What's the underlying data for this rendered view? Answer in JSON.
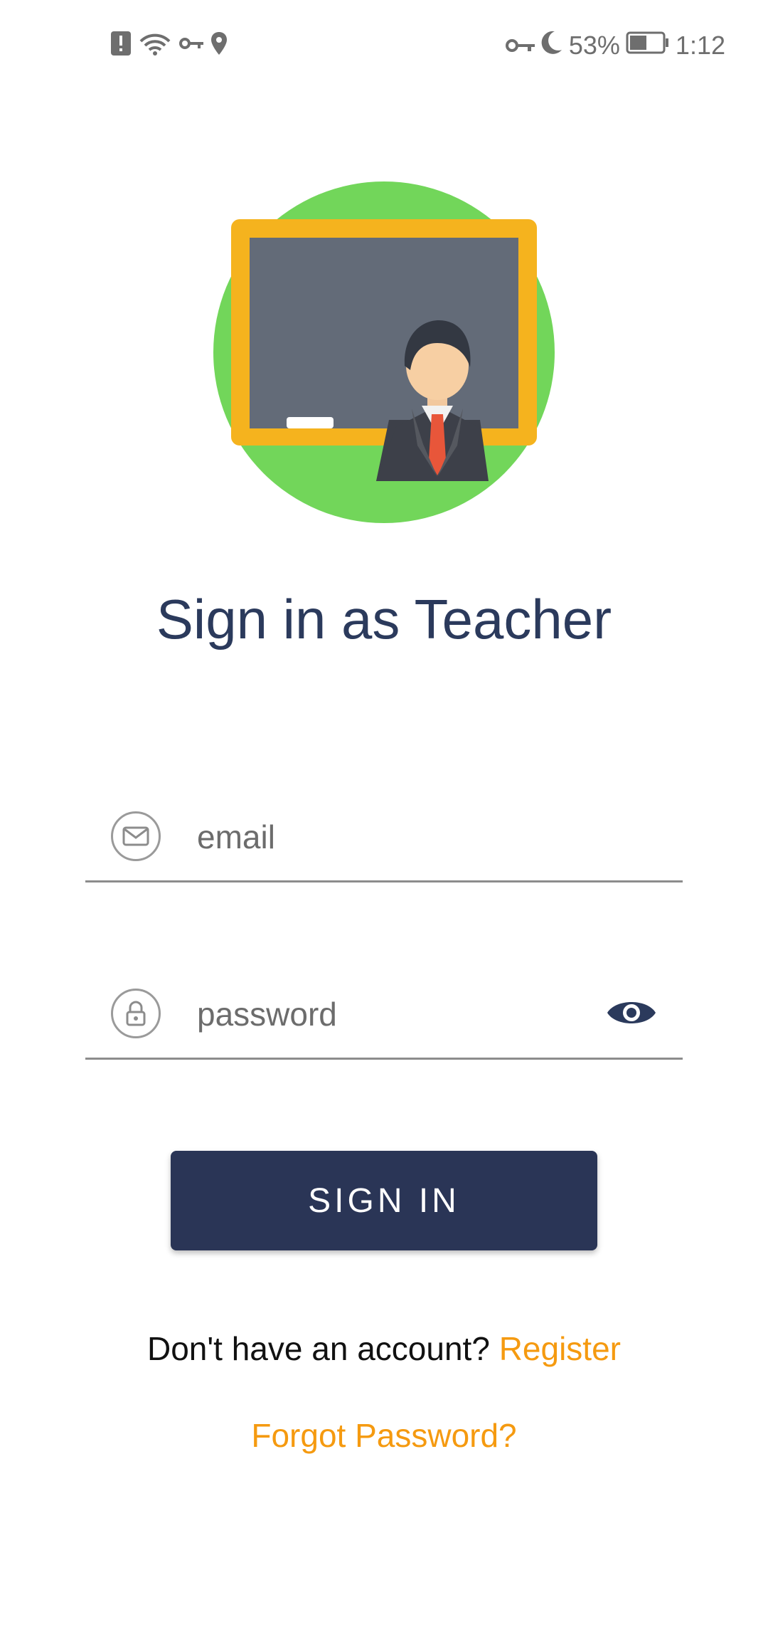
{
  "status_bar": {
    "battery_percent": "53%",
    "time": "1:12",
    "left_icons": [
      "alert-icon",
      "wifi-icon",
      "vpn-key-icon",
      "location-icon"
    ],
    "right_icons": [
      "vpn-key-icon",
      "moon-icon",
      "battery-icon"
    ],
    "battery_level": 0.53
  },
  "illustration": {
    "icon": "teacher-chalkboard-illustration"
  },
  "title": "Sign in as Teacher",
  "email_field": {
    "placeholder": "email",
    "value": "",
    "icon": "mail-icon"
  },
  "password_field": {
    "placeholder": "password",
    "value": "",
    "icon": "lock-icon",
    "toggle_icon": "eye-icon"
  },
  "sign_in_button": {
    "label": "SIGN IN"
  },
  "register": {
    "prompt": "Don't have an account?",
    "link": "Register"
  },
  "forgot_password": "Forgot Password?",
  "colors": {
    "primary": "#2a3556",
    "accent": "#f59a10",
    "title": "#2b3a5c",
    "circle": "#72d65a",
    "board_frame": "#f5b31e",
    "board": "#636b78"
  }
}
